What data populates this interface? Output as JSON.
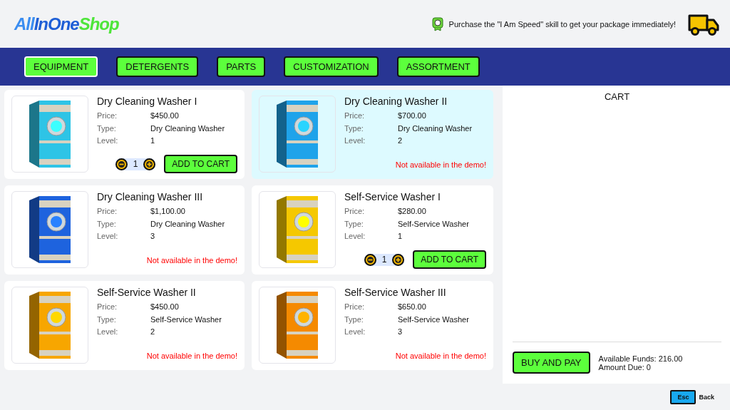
{
  "logo": {
    "part_1": "All",
    "part_2": "InOne",
    "part_3": "Shop"
  },
  "promo": {
    "text": "Purchase the \"I Am Speed\" skill to get your package immediately!"
  },
  "tabs": [
    {
      "label": "EQUIPMENT",
      "selected": true
    },
    {
      "label": "DETERGENTS",
      "selected": false
    },
    {
      "label": "PARTS",
      "selected": false
    },
    {
      "label": "CUSTOMIZATION",
      "selected": false
    },
    {
      "label": "ASSORTMENT",
      "selected": false
    }
  ],
  "products": [
    {
      "name": "Dry Cleaning Washer I",
      "color": "#2ec4e6",
      "highlighted": false,
      "kind": "available",
      "price_label": "Price:",
      "price": "$450.00",
      "type_label": "Type:",
      "type": "Dry Cleaning Washer",
      "level_label": "Level:",
      "level": "1",
      "quantity": "1",
      "button": "ADD TO CART"
    },
    {
      "name": "Dry Cleaning Washer II",
      "color": "#1fa3ea",
      "highlighted": true,
      "kind": "unavailable",
      "price_label": "Price:",
      "price": "$700.00",
      "type_label": "Type:",
      "type": "Dry Cleaning Washer",
      "level_label": "Level:",
      "level": "2",
      "note": "Not available in the demo!"
    },
    {
      "name": "Dry Cleaning Washer III",
      "color": "#1e63de",
      "highlighted": false,
      "kind": "unavailable",
      "price_label": "Price:",
      "price": "$1,100.00",
      "type_label": "Type:",
      "type": "Dry Cleaning Washer",
      "level_label": "Level:",
      "level": "3",
      "note": "Not available in the demo!"
    },
    {
      "name": "Self-Service Washer I",
      "color": "#f5c800",
      "highlighted": false,
      "kind": "available",
      "price_label": "Price:",
      "price": "$280.00",
      "type_label": "Type:",
      "type": "Self-Service Washer",
      "level_label": "Level:",
      "level": "1",
      "quantity": "1",
      "button": "ADD TO CART"
    },
    {
      "name": "Self-Service Washer II",
      "color": "#f7a600",
      "highlighted": false,
      "kind": "unavailable",
      "price_label": "Price:",
      "price": "$450.00",
      "type_label": "Type:",
      "type": "Self-Service Washer",
      "level_label": "Level:",
      "level": "2",
      "note": "Not available in the demo!"
    },
    {
      "name": "Self-Service Washer III",
      "color": "#f58a00",
      "highlighted": false,
      "kind": "unavailable",
      "price_label": "Price:",
      "price": "$650.00",
      "type_label": "Type:",
      "type": "Self-Service Washer",
      "level_label": "Level:",
      "level": "3",
      "note": "Not available in the demo!"
    }
  ],
  "cart": {
    "title": "CART",
    "button": "BUY AND PAY",
    "funds": "Available Funds: 216.00",
    "due": "Amount Due: 0"
  },
  "footer": {
    "key": "Esc",
    "action": "Back"
  }
}
